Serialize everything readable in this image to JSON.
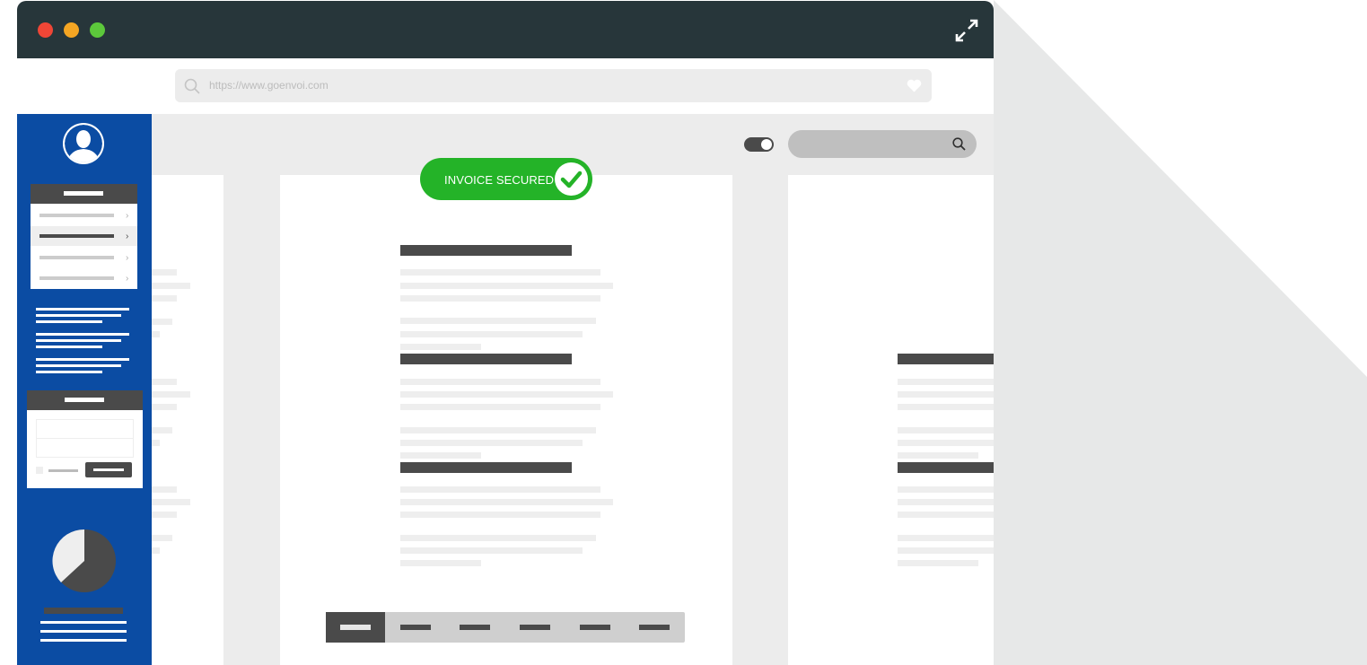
{
  "browser": {
    "url": "https://www.goenvoi.com",
    "window_controls": [
      "close",
      "minimize",
      "maximize"
    ],
    "expand_icon": "expand-arrows-icon",
    "favorite_icon": "heart-icon",
    "search_icon": "search-icon"
  },
  "badge": {
    "label": "INVOICE SECURED",
    "icon": "checkmark-icon"
  },
  "colors": {
    "titlebar": "#27363a",
    "sidebar": "#0b4ca3",
    "badge": "#24b328",
    "close": "#ef4636",
    "minimize": "#f5a623",
    "maximize": "#5cc83b"
  },
  "pager": {
    "pages": 6,
    "active_index": 0
  },
  "sidebar": {
    "avatar_icon": "user-avatar-icon",
    "chart_icon": "pie-chart-icon"
  }
}
